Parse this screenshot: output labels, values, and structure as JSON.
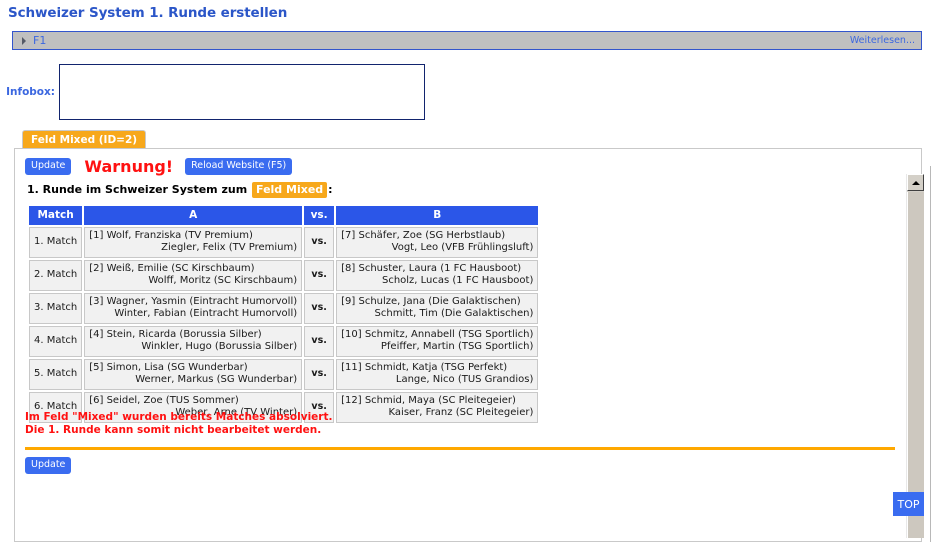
{
  "page": {
    "title": "Schweizer System 1. Runde erstellen"
  },
  "f1_bar": {
    "label": "F1",
    "more_link": "Weiterlesen...",
    "marker_icon": "triangle-right-icon"
  },
  "infobox": {
    "label": "Infobox:",
    "value": "",
    "placeholder": ""
  },
  "tab": {
    "label": "Feld Mixed (ID=2)"
  },
  "toolbar": {
    "update_label": "Update",
    "warning_word": "Warnung!",
    "reload_label": "Reload Website (F5)"
  },
  "round_caption": {
    "prefix": "1. Runde im Schweizer System zum",
    "field_chip": "Feld Mixed",
    "suffix": ":"
  },
  "matches_table": {
    "headers": {
      "match": "Match",
      "a": "A",
      "vs": "vs.",
      "b": "B"
    },
    "vs_label": "vs.",
    "rows": [
      {
        "match": "1. Match",
        "a_line1": "[1] Wolf, Franziska (TV Premium)",
        "a_line2": "Ziegler, Felix (TV Premium)",
        "b_line1": "[7] Schäfer, Zoe (SG Herbstlaub)",
        "b_line2": "Vogt, Leo (VFB Frühlingsluft)"
      },
      {
        "match": "2. Match",
        "a_line1": "[2] Weiß, Emilie (SC Kirschbaum)",
        "a_line2": "Wolff, Moritz (SC Kirschbaum)",
        "b_line1": "[8] Schuster, Laura (1 FC Hausboot)",
        "b_line2": "Scholz, Lucas (1 FC Hausboot)"
      },
      {
        "match": "3. Match",
        "a_line1": "[3] Wagner, Yasmin (Eintracht Humorvoll)",
        "a_line2": "Winter, Fabian (Eintracht Humorvoll)",
        "b_line1": "[9] Schulze, Jana (Die Galaktischen)",
        "b_line2": "Schmitt, Tim (Die Galaktischen)"
      },
      {
        "match": "4. Match",
        "a_line1": "[4] Stein, Ricarda (Borussia Silber)",
        "a_line2": "Winkler, Hugo (Borussia Silber)",
        "b_line1": "[10] Schmitz, Annabell (TSG Sportlich)",
        "b_line2": "Pfeiffer, Martin (TSG Sportlich)"
      },
      {
        "match": "5. Match",
        "a_line1": "[5] Simon, Lisa (SG Wunderbar)",
        "a_line2": "Werner, Markus (SG Wunderbar)",
        "b_line1": "[11] Schmidt, Katja (TSG Perfekt)",
        "b_line2": "Lange, Nico (TUS Grandios)"
      },
      {
        "match": "6. Match",
        "a_line1": "[6] Seidel, Zoe (TUS Sommer)",
        "a_line2": "Weber, Arne (TV Winter)",
        "b_line1": "[12] Schmid, Maya (SC Pleitegeier)",
        "b_line2": "Kaiser, Franz (SC Pleitegeier)"
      }
    ]
  },
  "bottom_warning": {
    "line1": "Im Feld \"Mixed\" wurden bereits Matches absolviert.",
    "line2": "Die 1. Runde kann somit nicht bearbeitet werden."
  },
  "bottom_update": {
    "label": "Update"
  },
  "scrollbar": {
    "up_arrow_icon": "triangle-up-icon"
  },
  "top_button": {
    "label": "TOP"
  },
  "colors": {
    "heading_blue": "#2b56c8",
    "link_blue": "#3b67e0",
    "button_blue": "#3a6cf0",
    "table_header_blue": "#2b56e8",
    "tab_orange": "#f7a81b",
    "warning_red": "#ff1111",
    "divider_orange": "#ffa800",
    "bar_gray": "#c0c0c0"
  }
}
